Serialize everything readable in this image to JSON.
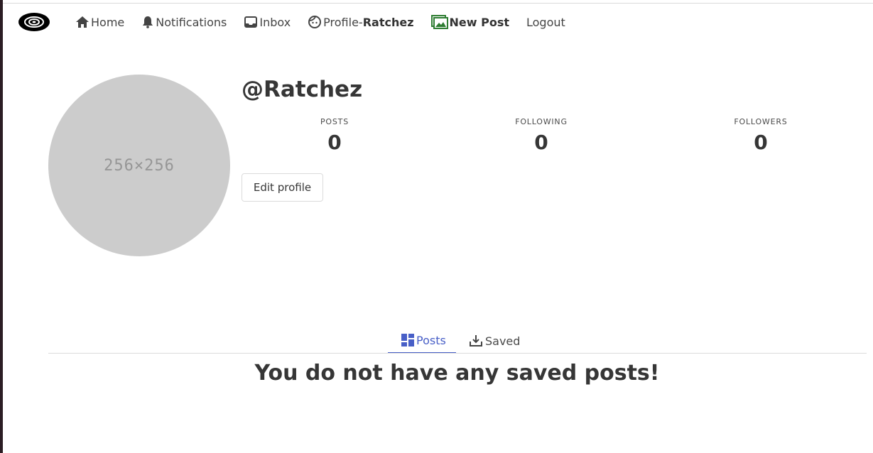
{
  "nav": {
    "home": "Home",
    "notifications": "Notifications",
    "inbox": "Inbox",
    "profile_prefix": "Profile-",
    "profile_user": "Ratchez",
    "new_post": "New Post",
    "logout": "Logout"
  },
  "profile": {
    "avatar_placeholder": "256×256",
    "username": "@Ratchez",
    "stats": [
      {
        "label": "POSTS",
        "value": "0"
      },
      {
        "label": "FOLLOWING",
        "value": "0"
      },
      {
        "label": "FOLLOWERS",
        "value": "0"
      }
    ],
    "edit_button": "Edit profile"
  },
  "tabs": [
    {
      "label": "Posts",
      "active": true
    },
    {
      "label": "Saved",
      "active": false
    }
  ],
  "content": {
    "empty_message": "You do not have any saved posts!"
  },
  "colors": {
    "accent": "#485fc7",
    "new_post_icon": "#2e7d32",
    "avatar_bg": "#cccccc"
  }
}
